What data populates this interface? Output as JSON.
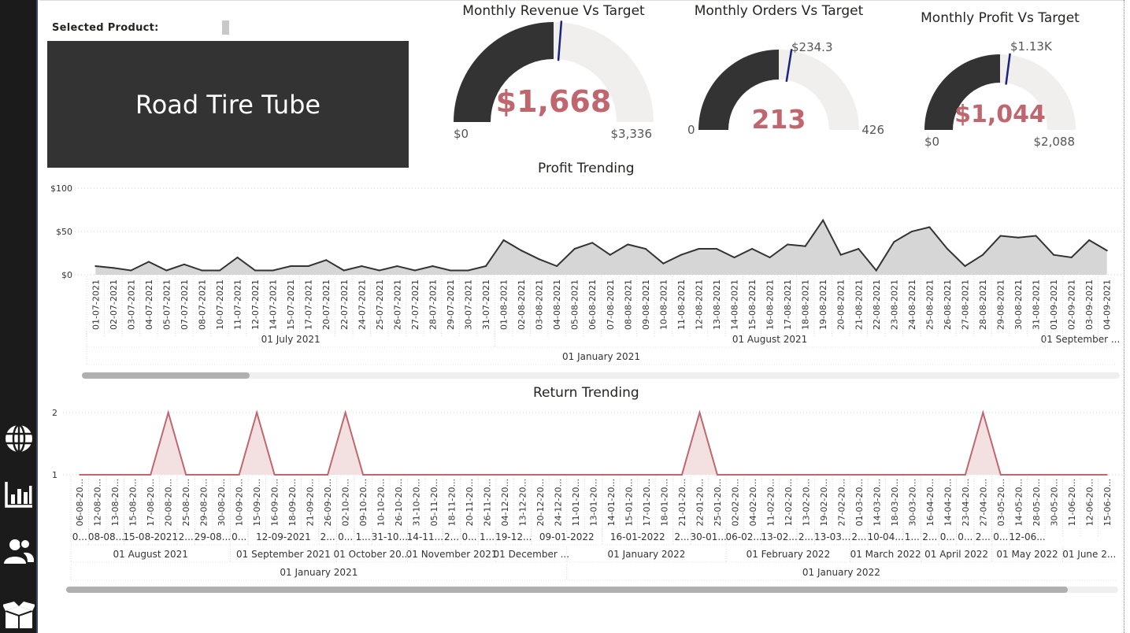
{
  "sidebar": {
    "items": [
      {
        "name": "globe-icon"
      },
      {
        "name": "bar-chart-icon"
      },
      {
        "name": "users-icon"
      },
      {
        "name": "box-icon"
      }
    ]
  },
  "slicer": {
    "label": "Selected Product:",
    "value": "Road Tire Tube"
  },
  "colors": {
    "accent": "#c0666e",
    "dark": "#333333",
    "gauge_track": "#f1efee",
    "target": "#1a237e"
  },
  "gauges": [
    {
      "title": "Monthly Revenue Vs Target",
      "value_text": "$1,668",
      "target_text": "",
      "min_text": "$0",
      "max_text": "$3,336",
      "value": 1668,
      "target": 1750,
      "min": 0,
      "max": 3336
    },
    {
      "title": "Monthly Orders Vs Target",
      "value_text": "213",
      "target_text": "$234.3",
      "min_text": "0",
      "max_text": "426",
      "value": 213,
      "target": 234.3,
      "min": 0,
      "max": 426
    },
    {
      "title": "Monthly Profit Vs Target",
      "value_text": "$1,044",
      "target_text": "$1.13K",
      "min_text": "$0",
      "max_text": "$2,088",
      "value": 1044,
      "target": 1130,
      "min": 0,
      "max": 2088
    }
  ],
  "chart_data": [
    {
      "type": "area",
      "title": "Profit Trending",
      "ylim": [
        0,
        100
      ],
      "yticks": [
        "$0",
        "$50",
        "$100"
      ],
      "grid": true,
      "x": [
        "01-07-2021",
        "02-07-2021",
        "03-07-2021",
        "04-07-2021",
        "05-07-2021",
        "07-07-2021",
        "08-07-2021",
        "10-07-2021",
        "11-07-2021",
        "12-07-2021",
        "14-07-2021",
        "15-07-2021",
        "17-07-2021",
        "20-07-2021",
        "22-07-2021",
        "24-07-2021",
        "25-07-2021",
        "26-07-2021",
        "27-07-2021",
        "28-07-2021",
        "29-07-2021",
        "30-07-2021",
        "31-07-2021",
        "01-08-2021",
        "02-08-2021",
        "03-08-2021",
        "04-08-2021",
        "05-08-2021",
        "06-08-2021",
        "07-08-2021",
        "08-08-2021",
        "09-08-2021",
        "10-08-2021",
        "11-08-2021",
        "12-08-2021",
        "13-08-2021",
        "14-08-2021",
        "15-08-2021",
        "16-08-2021",
        "17-08-2021",
        "18-08-2021",
        "19-08-2021",
        "20-08-2021",
        "21-08-2021",
        "22-08-2021",
        "23-08-2021",
        "24-08-2021",
        "25-08-2021",
        "26-08-2021",
        "27-08-2021",
        "28-08-2021",
        "29-08-2021",
        "30-08-2021",
        "31-08-2021",
        "01-09-2021",
        "02-09-2021",
        "03-09-2021",
        "04-09-2021"
      ],
      "values": [
        10,
        8,
        5,
        15,
        5,
        12,
        5,
        5,
        20,
        5,
        5,
        10,
        10,
        17,
        5,
        10,
        5,
        10,
        5,
        10,
        5,
        5,
        10,
        40,
        28,
        18,
        10,
        30,
        37,
        23,
        35,
        30,
        13,
        23,
        30,
        30,
        20,
        30,
        20,
        35,
        33,
        63,
        23,
        30,
        5,
        38,
        50,
        55,
        30,
        10,
        23,
        45,
        43,
        45,
        23,
        20,
        40,
        28
      ],
      "level1": [
        {
          "label": "01 July 2021",
          "count": 23
        },
        {
          "label": "01 August 2021",
          "count": 31
        },
        {
          "label": "01 September ...",
          "count": 4
        }
      ],
      "level2": [
        {
          "label": "01 January 2021",
          "count": 58
        }
      ]
    },
    {
      "type": "area",
      "title": "Return Trending",
      "ylim": [
        1,
        2
      ],
      "yticks": [
        "1",
        "2"
      ],
      "grid": true,
      "x": [
        "06-08-20...",
        "12-08-20...",
        "13-08-20...",
        "15-08-20...",
        "17-08-20...",
        "20-08-20...",
        "25-08-20...",
        "29-08-20...",
        "30-08-20...",
        "10-09-20...",
        "15-09-20...",
        "16-09-20...",
        "18-09-20...",
        "21-09-20...",
        "26-09-20...",
        "02-10-20...",
        "09-10-20...",
        "10-10-20...",
        "26-10-20...",
        "31-10-20...",
        "05-11-20...",
        "18-11-20...",
        "20-11-20...",
        "26-11-20...",
        "04-12-20...",
        "13-12-20...",
        "20-12-20...",
        "24-12-20...",
        "11-01-20...",
        "13-01-20...",
        "14-01-20...",
        "15-01-20...",
        "17-01-20...",
        "18-01-20...",
        "21-01-20...",
        "22-01-20...",
        "25-01-20...",
        "02-02-20...",
        "04-02-20...",
        "11-02-20...",
        "12-02-20...",
        "13-02-20...",
        "19-02-20...",
        "27-02-20...",
        "01-03-20...",
        "14-03-20...",
        "18-03-20...",
        "30-03-20...",
        "16-04-20...",
        "14-04-20...",
        "23-04-20...",
        "27-04-20...",
        "03-05-20...",
        "14-05-20...",
        "28-05-20...",
        "30-05-20...",
        "11-06-20...",
        "12-06-20...",
        "15-06-20..."
      ],
      "values": [
        1,
        1,
        1,
        1,
        1,
        2,
        1,
        1,
        1,
        1,
        2,
        1,
        1,
        1,
        1,
        2,
        1,
        1,
        1,
        1,
        1,
        1,
        1,
        1,
        1,
        1,
        1,
        1,
        1,
        1,
        1,
        1,
        1,
        1,
        1,
        2,
        1,
        1,
        1,
        1,
        1,
        1,
        1,
        1,
        1,
        1,
        1,
        1,
        1,
        1,
        1,
        2,
        1,
        1,
        1,
        1,
        1,
        1,
        1
      ],
      "level1": [
        {
          "label": "0...",
          "count": 1
        },
        {
          "label": "08-08...",
          "count": 2
        },
        {
          "label": "15-08-2021",
          "count": 3
        },
        {
          "label": "2...",
          "count": 1
        },
        {
          "label": "29-08...",
          "count": 2
        },
        {
          "label": "0...",
          "count": 1
        },
        {
          "label": "12-09-2021",
          "count": 4
        },
        {
          "label": "2...",
          "count": 1
        },
        {
          "label": "0...",
          "count": 1
        },
        {
          "label": "1...",
          "count": 1
        },
        {
          "label": "31-10...",
          "count": 2
        },
        {
          "label": "14-11...",
          "count": 2
        },
        {
          "label": "2...",
          "count": 1
        },
        {
          "label": "0...",
          "count": 1
        },
        {
          "label": "1...",
          "count": 1
        },
        {
          "label": "19-12...",
          "count": 2
        },
        {
          "label": "09-01-2022",
          "count": 4
        },
        {
          "label": "16-01-2022",
          "count": 4
        },
        {
          "label": "2...",
          "count": 1
        },
        {
          "label": "30-01...",
          "count": 2
        },
        {
          "label": "06-02...",
          "count": 2
        },
        {
          "label": "13-02...",
          "count": 2
        },
        {
          "label": "2...",
          "count": 1
        },
        {
          "label": "13-03...",
          "count": 2
        },
        {
          "label": "2...",
          "count": 1
        },
        {
          "label": "10-04...",
          "count": 2
        },
        {
          "label": "1...",
          "count": 1
        },
        {
          "label": "2...",
          "count": 1
        },
        {
          "label": "0...",
          "count": 1
        },
        {
          "label": "0...",
          "count": 1
        },
        {
          "label": "2...",
          "count": 1
        },
        {
          "label": "0...",
          "count": 1
        },
        {
          "label": "12-06...",
          "count": 2
        }
      ],
      "level2": [
        {
          "label": "01 August 2021",
          "count": 9
        },
        {
          "label": "01 September 2021",
          "count": 6
        },
        {
          "label": "01 October 20...",
          "count": 4
        },
        {
          "label": "01 November 2021",
          "count": 5
        },
        {
          "label": "01 December ...",
          "count": 4
        },
        {
          "label": "01 January 2022",
          "count": 9
        },
        {
          "label": "01 February 2022",
          "count": 7
        },
        {
          "label": "01 March 2022",
          "count": 4
        },
        {
          "label": "01 April 2022",
          "count": 4
        },
        {
          "label": "01 May 2022",
          "count": 4
        },
        {
          "label": "01 June 2...",
          "count": 3
        }
      ],
      "level3": [
        {
          "label": "01 January 2021",
          "count": 28
        },
        {
          "label": "01 January 2022",
          "count": 31
        }
      ]
    }
  ]
}
